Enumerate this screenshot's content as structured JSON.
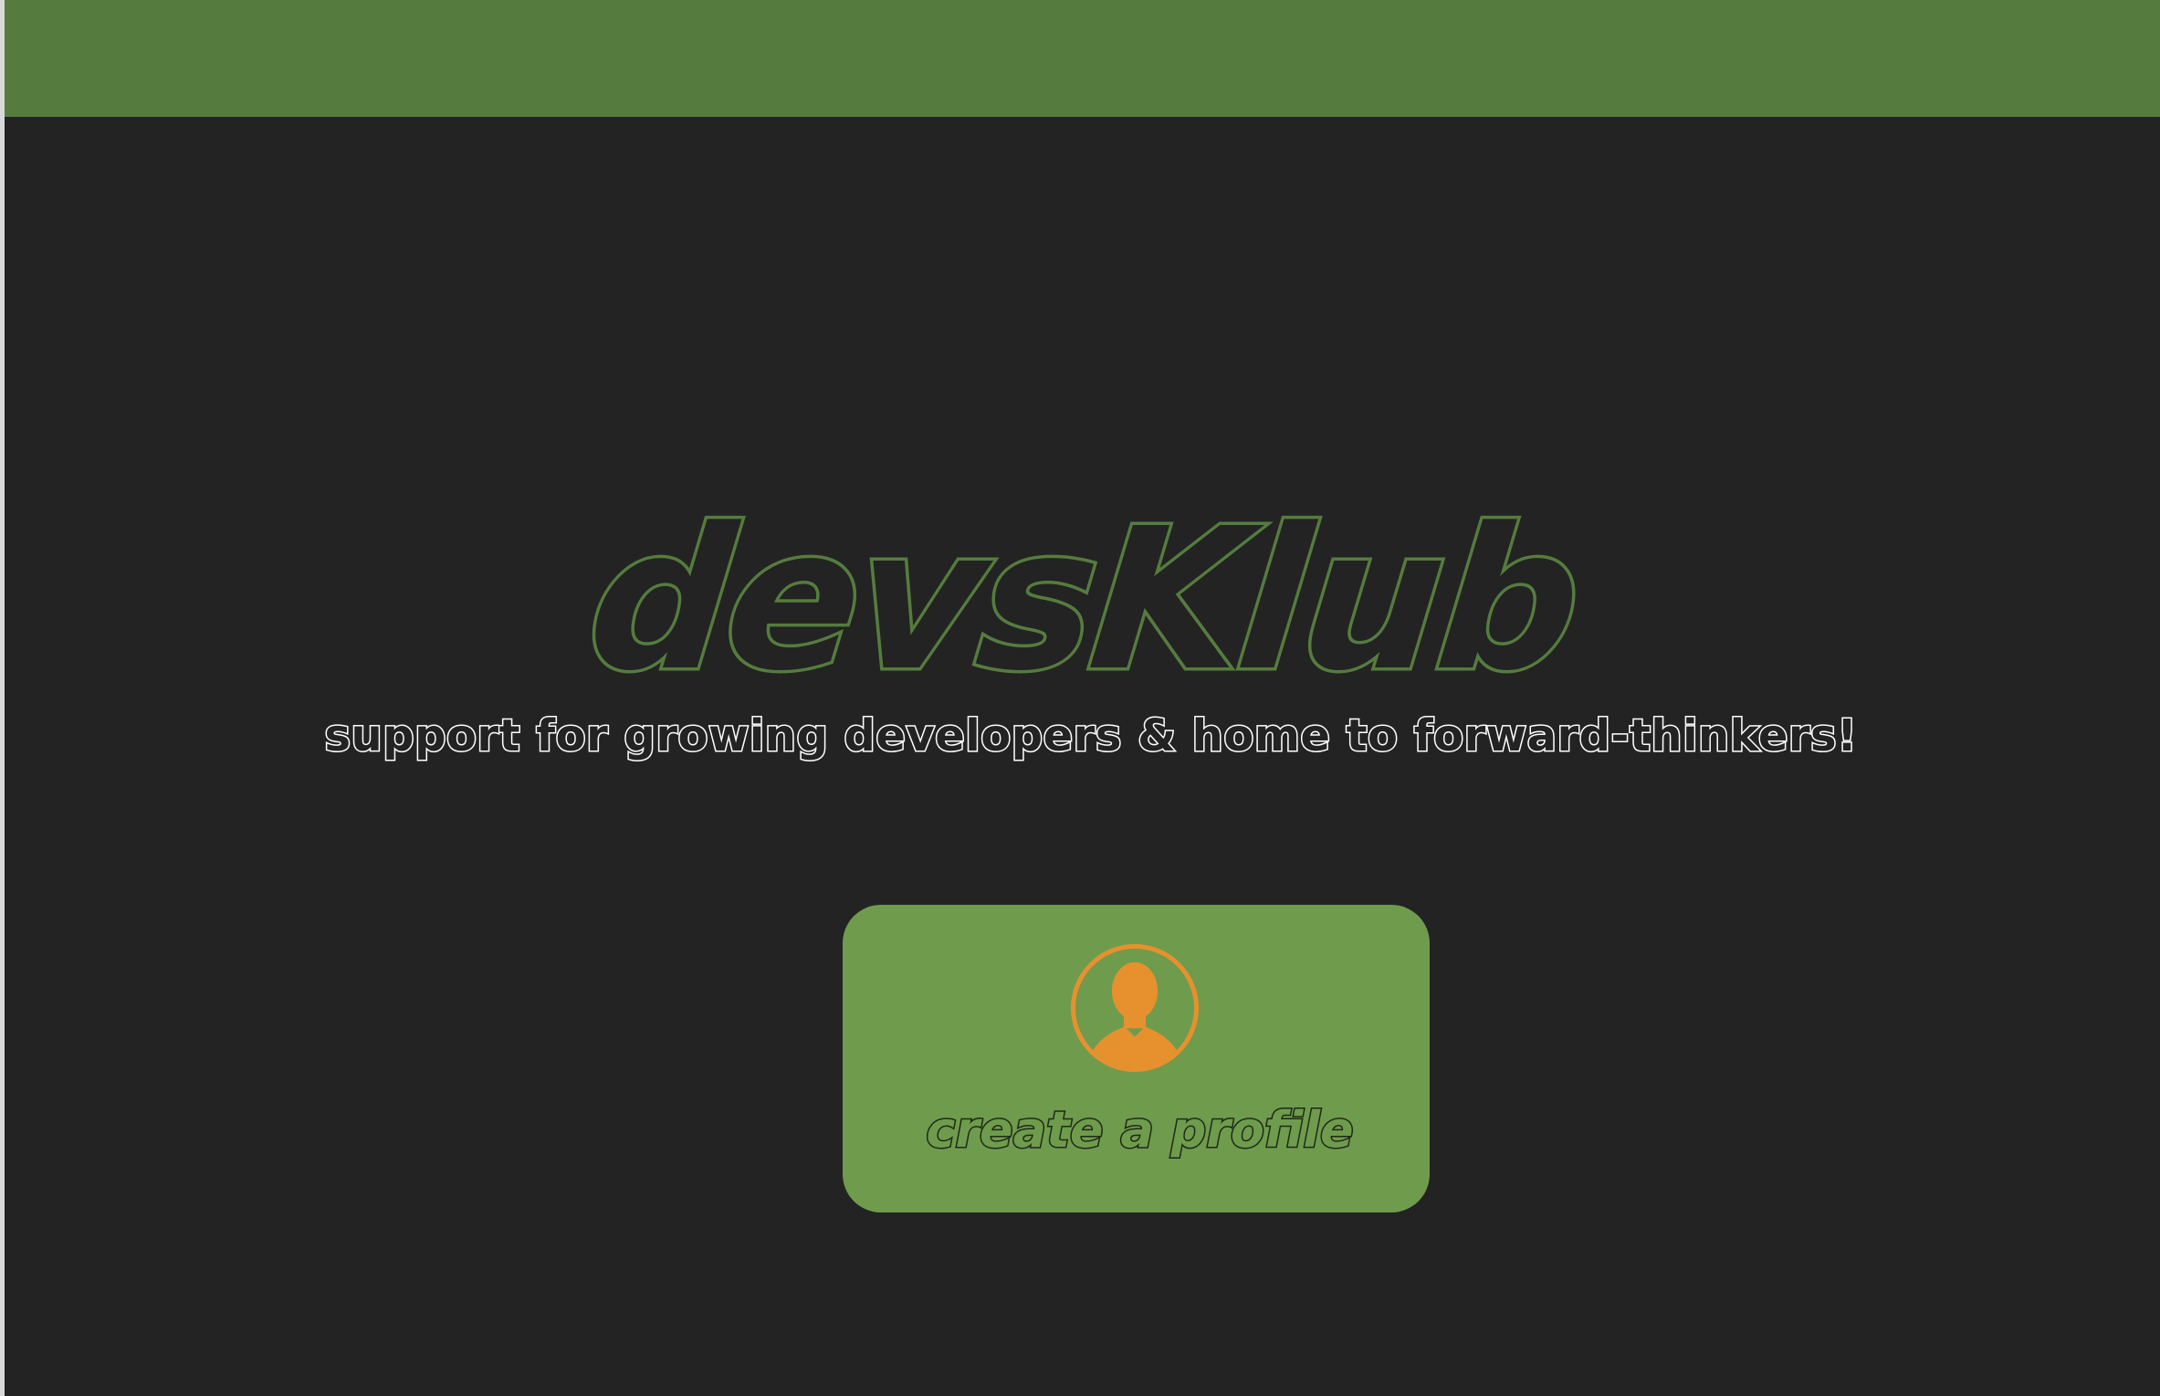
{
  "brand": {
    "name": "devsKlub",
    "tagline": "support for growing developers & home to forward-thinkers!"
  },
  "cta": {
    "label": "create a profile",
    "icon": "user-avatar-icon"
  },
  "colors": {
    "background": "#232323",
    "topbar": "#557c3e",
    "brand_green": "#557c3e",
    "button_green": "#6f9b4d",
    "avatar_orange": "#e6912e",
    "tagline_outline": "#ffffff"
  }
}
